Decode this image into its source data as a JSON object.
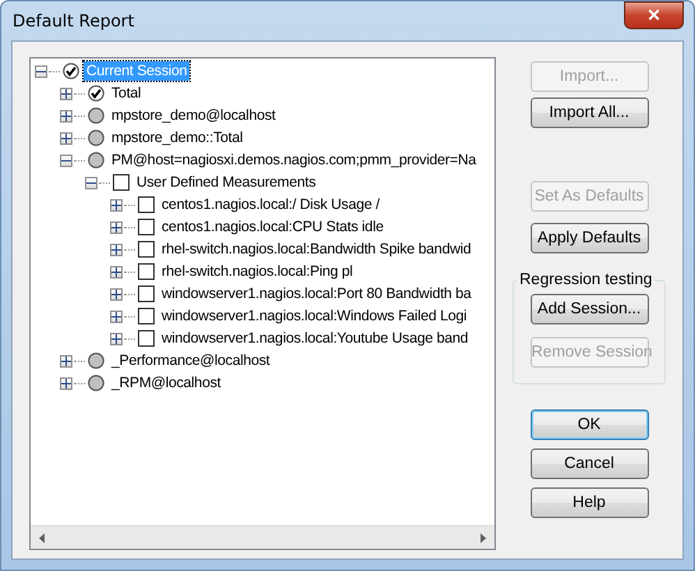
{
  "window": {
    "title": "Default Report",
    "close_label": "✕"
  },
  "tree": [
    {
      "label": "Current Session",
      "kind": "circle",
      "checked": true,
      "selected": true,
      "expanded": true,
      "children": [
        {
          "label": "Total",
          "kind": "circle",
          "checked": true,
          "selected": false,
          "expanded": false
        },
        {
          "label": "mpstore_demo@localhost",
          "kind": "circle",
          "checked": false,
          "selected": false,
          "expanded": false
        },
        {
          "label": "mpstore_demo::Total",
          "kind": "circle",
          "checked": false,
          "selected": false,
          "expanded": false
        },
        {
          "label": "PM@host=nagiosxi.demos.nagios.com;pmm_provider=Na",
          "kind": "circle",
          "checked": false,
          "selected": false,
          "expanded": true,
          "children": [
            {
              "label": "User Defined Measurements",
              "kind": "box",
              "checked": false,
              "selected": false,
              "expanded": true,
              "children": [
                {
                  "label": "centos1.nagios.local:/ Disk Usage /",
                  "kind": "box",
                  "checked": false,
                  "selected": false,
                  "expanded": false
                },
                {
                  "label": "centos1.nagios.local:CPU Stats idle",
                  "kind": "box",
                  "checked": false,
                  "selected": false,
                  "expanded": false
                },
                {
                  "label": "rhel-switch.nagios.local:Bandwidth Spike bandwid",
                  "kind": "box",
                  "checked": false,
                  "selected": false,
                  "expanded": false
                },
                {
                  "label": "rhel-switch.nagios.local:Ping pl",
                  "kind": "box",
                  "checked": false,
                  "selected": false,
                  "expanded": false
                },
                {
                  "label": "windowserver1.nagios.local:Port 80 Bandwidth ba",
                  "kind": "box",
                  "checked": false,
                  "selected": false,
                  "expanded": false
                },
                {
                  "label": "windowserver1.nagios.local:Windows Failed Logi",
                  "kind": "box",
                  "checked": false,
                  "selected": false,
                  "expanded": false
                },
                {
                  "label": "windowserver1.nagios.local:Youtube Usage band",
                  "kind": "box",
                  "checked": false,
                  "selected": false,
                  "expanded": false
                }
              ]
            }
          ]
        },
        {
          "label": "_Performance@localhost",
          "kind": "circle",
          "checked": false,
          "selected": false,
          "expanded": false
        },
        {
          "label": "_RPM@localhost",
          "kind": "circle",
          "checked": false,
          "selected": false,
          "expanded": false
        }
      ]
    }
  ],
  "side_buttons": [
    {
      "label": "Import...",
      "disabled": true
    },
    {
      "label": "Import All...",
      "disabled": false
    },
    {
      "label": "Set As Defaults",
      "disabled": true
    },
    {
      "label": "Apply Defaults",
      "disabled": false
    }
  ],
  "regression_group": {
    "title": "Regression testing",
    "buttons": [
      {
        "label": "Add Session...",
        "disabled": false
      },
      {
        "label": "Remove Session",
        "disabled": true
      }
    ]
  },
  "dialog_buttons": [
    {
      "label": "OK",
      "default": true
    },
    {
      "label": "Cancel",
      "default": false
    },
    {
      "label": "Help",
      "default": false
    }
  ]
}
